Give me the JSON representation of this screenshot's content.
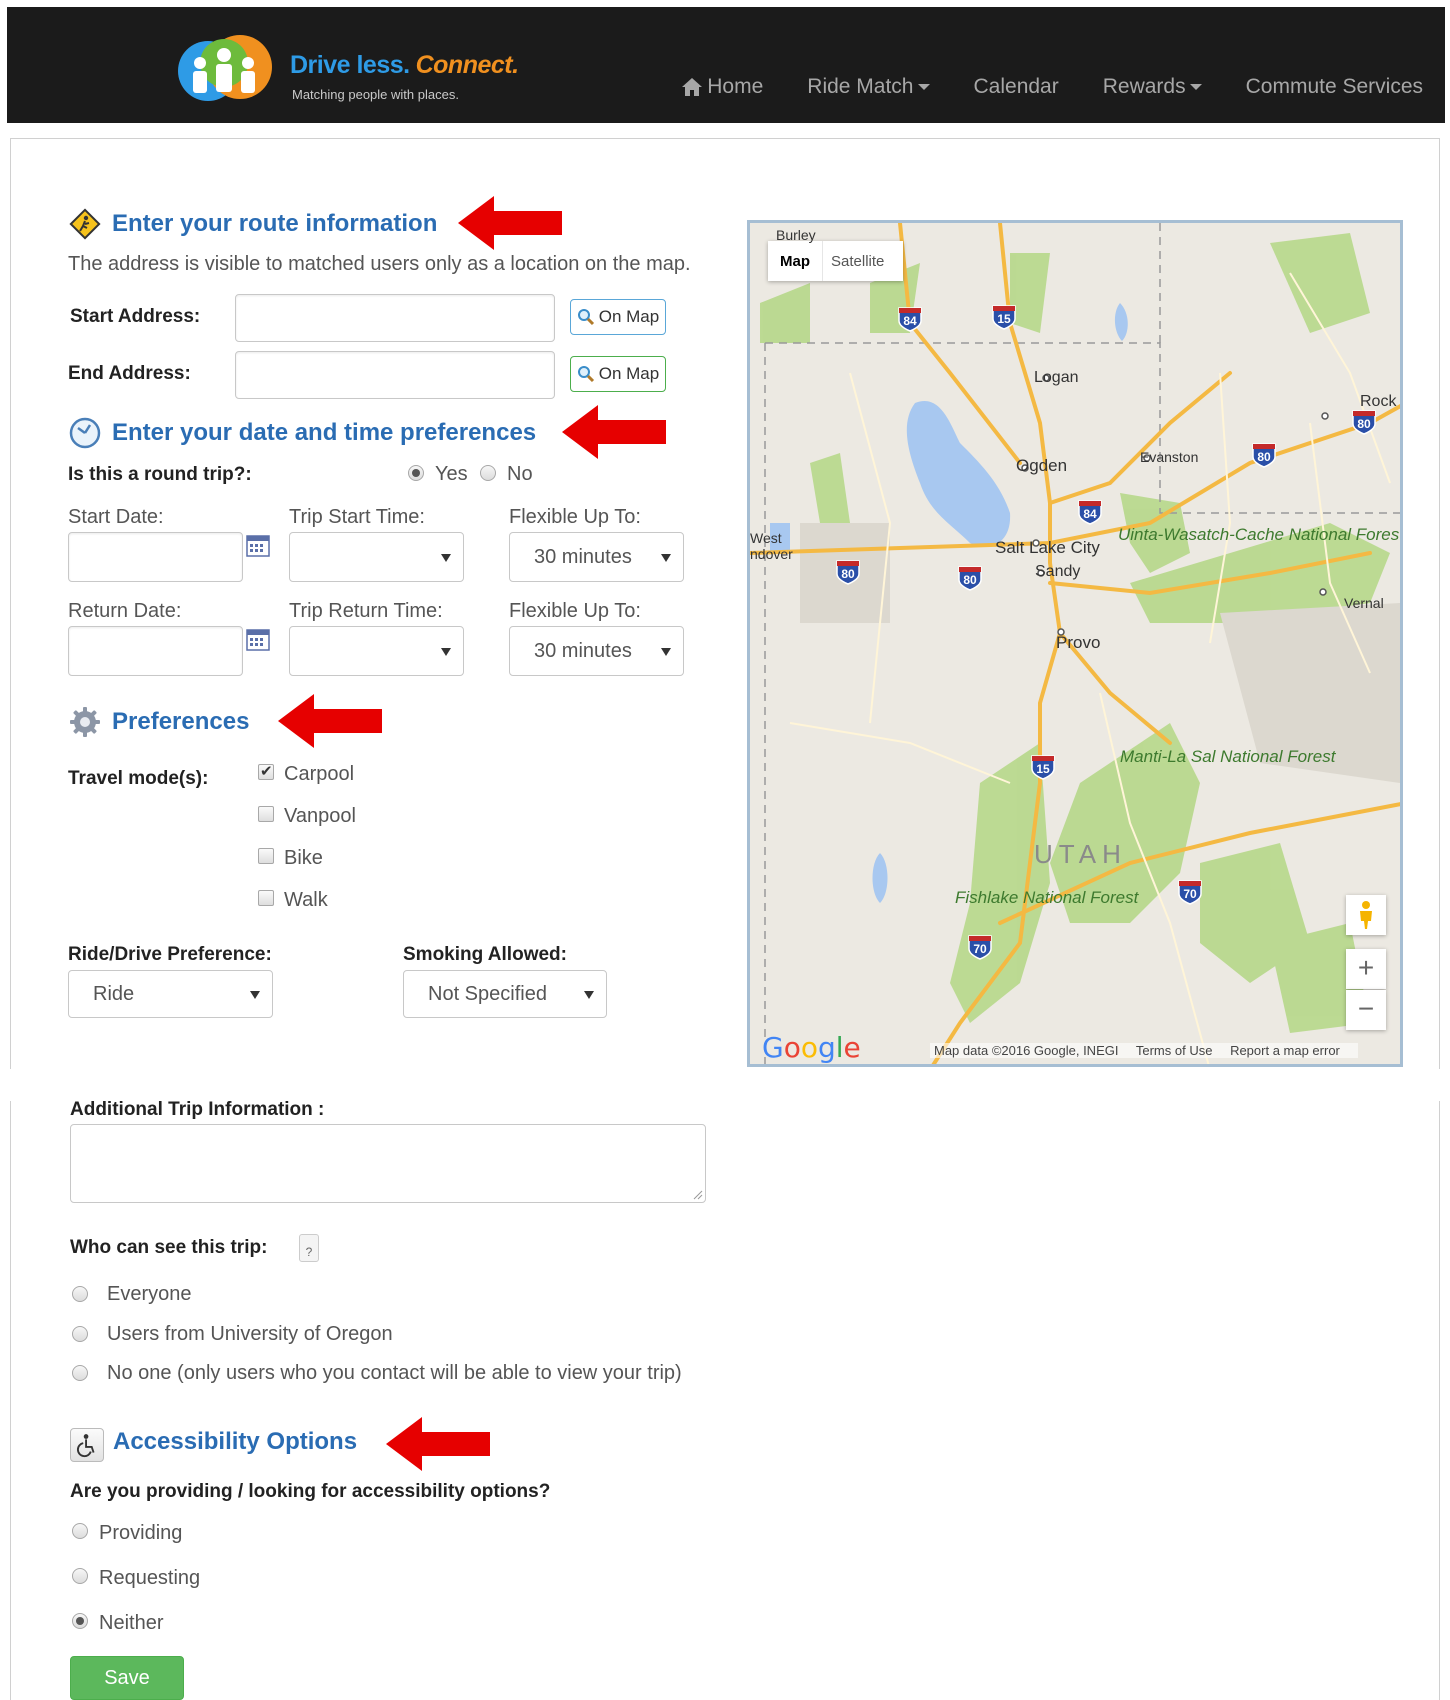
{
  "nav": {
    "logo_title_a": "Drive less.",
    "logo_title_b": "Connect.",
    "logo_sub": "Matching people with places.",
    "items": [
      {
        "label": "Home",
        "icon": "home-icon"
      },
      {
        "label": "Ride Match",
        "dropdown": true
      },
      {
        "label": "Calendar"
      },
      {
        "label": "Rewards",
        "dropdown": true
      },
      {
        "label": "Commute Services"
      }
    ]
  },
  "route": {
    "title": "Enter your route information",
    "note": "The address is visible to matched users only as a location on the map.",
    "start_label": "Start Address:",
    "end_label": "End Address:",
    "start_value": "",
    "end_value": "",
    "on_map": "On Map"
  },
  "datetime": {
    "title": "Enter your date and time preferences",
    "round_trip_label": "Is this a round trip?:",
    "yes": "Yes",
    "no": "No",
    "round_trip_selected": "Yes",
    "start_date_label": "Start Date:",
    "trip_start_label": "Trip Start Time:",
    "flex_label": "Flexible Up To:",
    "return_date_label": "Return Date:",
    "trip_return_label": "Trip Return Time:",
    "flex_start_value": "30 minutes",
    "flex_return_value": "30 minutes"
  },
  "prefs": {
    "title": "Preferences",
    "travel_label": "Travel mode(s):",
    "modes": [
      {
        "label": "Carpool",
        "checked": true
      },
      {
        "label": "Vanpool",
        "checked": false
      },
      {
        "label": "Bike",
        "checked": false
      },
      {
        "label": "Walk",
        "checked": false
      }
    ],
    "ride_drive_label": "Ride/Drive Preference:",
    "ride_drive_value": "Ride",
    "smoking_label": "Smoking Allowed:",
    "smoking_value": "Not Specified"
  },
  "extra": {
    "additional_label": "Additional Trip Information :",
    "visibility_label": "Who can see this trip:",
    "help": "?",
    "visibility_options": [
      "Everyone",
      "Users from University of Oregon",
      "No one (only users who you contact will be able to view your trip)"
    ]
  },
  "access": {
    "title": "Accessibility Options",
    "question": "Are you providing / looking for accessibility options?",
    "options": [
      "Providing",
      "Requesting",
      "Neither"
    ],
    "selected": "Neither",
    "save": "Save"
  },
  "map": {
    "type_map": "Map",
    "type_satellite": "Satellite",
    "labels": {
      "burley": "Burley",
      "logan": "Logan",
      "rock": "Rock",
      "evanston": "Evanston",
      "ogden": "Ogden",
      "west": "West",
      "wendover": "ndover",
      "slc": "Salt Lake City",
      "sandy": "Sandy",
      "provo": "Provo",
      "vernal": "Vernal",
      "uinta": "Uinta-Wasatch-Cache National Forest",
      "manti": "Manti-La Sal National Forest",
      "fishlake": "Fishlake National Forest",
      "utah": "UTAH"
    },
    "shields": [
      "84",
      "15",
      "80",
      "80",
      "84",
      "80",
      "80",
      "15",
      "70",
      "70"
    ],
    "zoom_in": "+",
    "zoom_out": "−",
    "google": "Google",
    "footer_data": "Map data ©2016 Google, INEGI",
    "footer_terms": "Terms of Use",
    "footer_report": "Report a map error"
  },
  "colors": {
    "heading_blue": "#2a6cb3",
    "arrow_red": "#e60000",
    "save_green": "#5cb85c",
    "navbar": "#1b1b1b"
  }
}
